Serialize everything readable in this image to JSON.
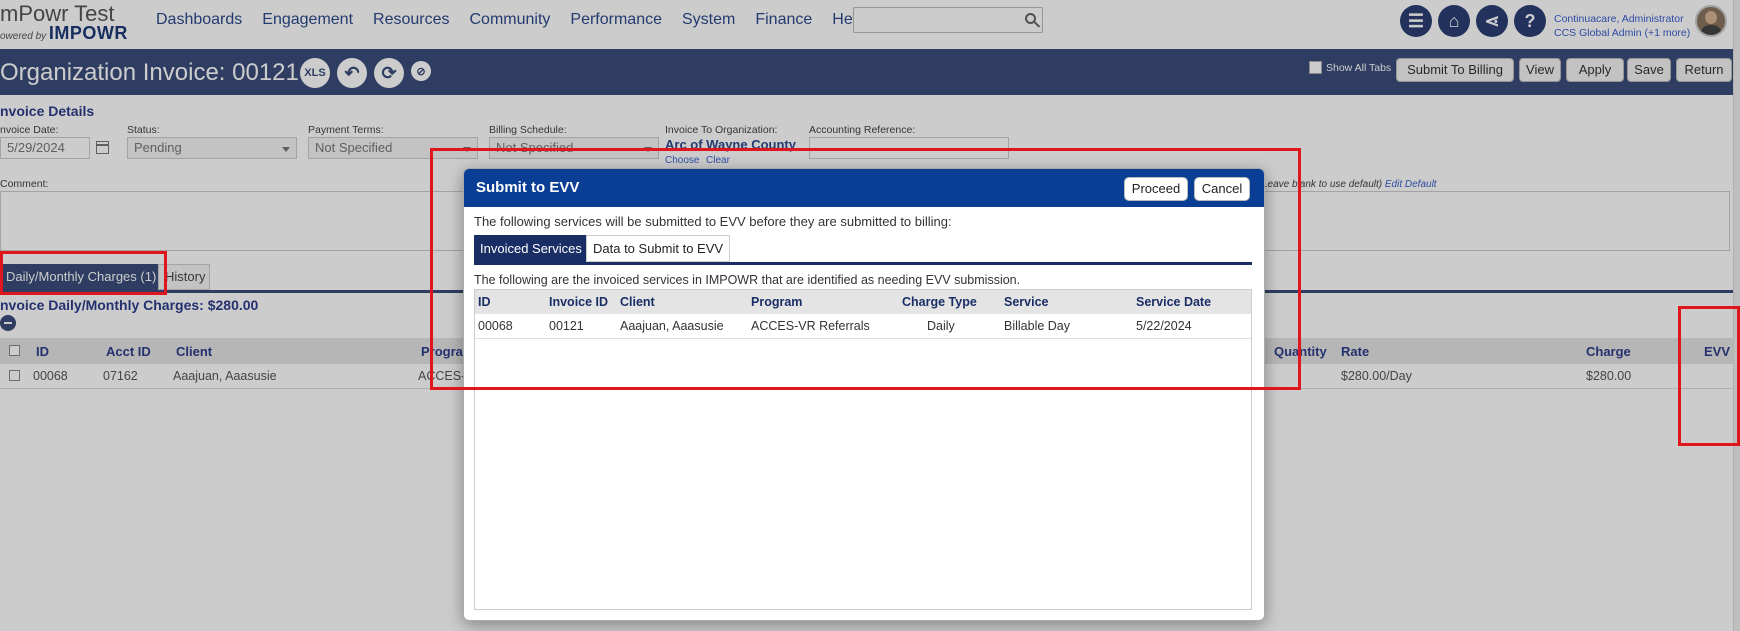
{
  "brand": {
    "title": "mPowr Test",
    "powered_by": "owered by",
    "logo": "IMPOWR"
  },
  "nav": [
    "Dashboards",
    "Engagement",
    "Resources",
    "Community",
    "Performance",
    "System",
    "Finance",
    "Help"
  ],
  "search": {
    "placeholder": ""
  },
  "header_icons": [
    "list-icon",
    "home-icon",
    "share-icon",
    "help-icon"
  ],
  "user": {
    "name": "Continuacare, Administrator",
    "role": "CCS Global Admin (+1 more)"
  },
  "page": {
    "title": "Organization Invoice: 00121",
    "xls_label": "XLS",
    "show_all_tabs": "Show All Tabs",
    "buttons": {
      "submit_to_billing": "Submit To Billing",
      "view": "View",
      "apply": "Apply",
      "save": "Save",
      "return": "Return"
    }
  },
  "details": {
    "heading": "nvoice Details",
    "invoice_date": {
      "label": "nvoice Date:",
      "value": "5/29/2024"
    },
    "status": {
      "label": "Status:",
      "value": "Pending"
    },
    "payment_terms": {
      "label": "Payment Terms:",
      "value": "Not Specified"
    },
    "billing_schedule": {
      "label": "Billing Schedule:",
      "value": "Not Specified"
    },
    "invoice_to_org": {
      "label": "Invoice To Organization:",
      "value": "Arc of Wayne County",
      "choose": "Choose",
      "clear": "Clear"
    },
    "accounting_reference": {
      "label": "Accounting Reference:",
      "value": ""
    },
    "comment_label": "Comment:",
    "default_note": "Leave blank to use default)",
    "edit_default": "Edit Default"
  },
  "tabs": {
    "charges": "Daily/Monthly Charges (1)",
    "history": "History"
  },
  "charges": {
    "heading": "nvoice Daily/Monthly Charges: $280.00",
    "columns": {
      "id": "ID",
      "acct_id": "Acct ID",
      "client": "Client",
      "program": "Progra",
      "quantity": "Quantity",
      "rate": "Rate",
      "charge": "Charge",
      "evv": "EVV"
    },
    "row": {
      "id": "00068",
      "acct_id": "07162",
      "client": "Aaajuan, Aaasusie",
      "program": "ACCES-",
      "rate": "$280.00/Day",
      "charge": "$280.00"
    }
  },
  "modal": {
    "title": "Submit to EVV",
    "proceed": "Proceed",
    "cancel": "Cancel",
    "message": "The following services will be submitted to EVV before they are submitted to billing:",
    "tabs": {
      "invoiced": "Invoiced Services",
      "data": "Data to Submit to EVV"
    },
    "subtext": "The following are the invoiced services in IMPOWR that are identified as needing EVV submission.",
    "columns": {
      "id": "ID",
      "invoice_id": "Invoice ID",
      "client": "Client",
      "program": "Program",
      "charge_type": "Charge Type",
      "service": "Service",
      "service_date": "Service Date"
    },
    "rows": [
      {
        "id": "00068",
        "invoice_id": "00121",
        "client": "Aaajuan, Aaasusie",
        "program": "ACCES-VR Referrals",
        "charge_type": "Daily",
        "service": "Billable Day",
        "service_date": "5/22/2024"
      }
    ]
  },
  "colors": {
    "nav_text": "#2d4a8c",
    "title_bar": "#3a4d7a",
    "modal_header": "#0a3e94",
    "annotation": "#e0161f"
  }
}
